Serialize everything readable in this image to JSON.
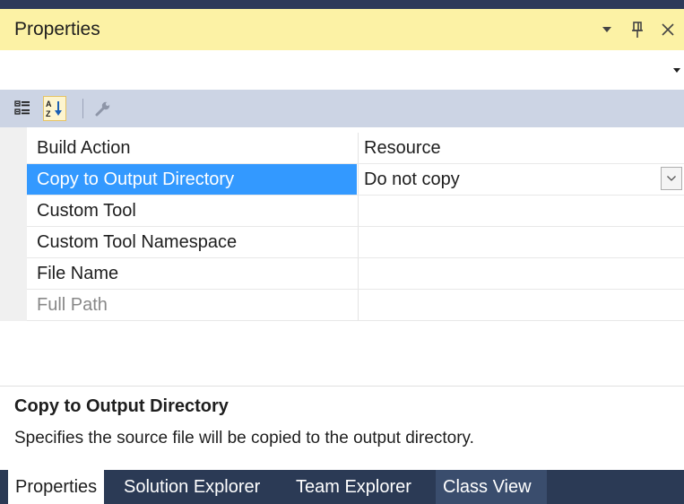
{
  "window": {
    "title": "Properties",
    "controls": [
      {
        "name": "dropdown-icon"
      },
      {
        "name": "pin-icon"
      },
      {
        "name": "close-icon"
      }
    ]
  },
  "toolbar": {
    "buttons": [
      {
        "name": "categorized-icon",
        "active": false
      },
      {
        "name": "alphabetical-sort-icon",
        "active": true
      },
      {
        "name": "property-pages-wrench-icon",
        "active": false,
        "disabled": true
      }
    ]
  },
  "properties": [
    {
      "name": "Build Action",
      "value": "Resource"
    },
    {
      "name": "Copy to Output Directory",
      "value": "Do not copy",
      "selected": true,
      "has_dropdown": true
    },
    {
      "name": "Custom Tool",
      "value": ""
    },
    {
      "name": "Custom Tool Namespace",
      "value": ""
    },
    {
      "name": "File Name",
      "value": ""
    },
    {
      "name": "Full Path",
      "value": "",
      "readonly": true
    }
  ],
  "description": {
    "title": "Copy to Output Directory",
    "text": "Specifies the source file will be copied to the output directory."
  },
  "tabs": [
    {
      "label": "Properties",
      "active": true
    },
    {
      "label": "Solution Explorer"
    },
    {
      "label": "Team Explorer"
    },
    {
      "label": "Class View"
    }
  ],
  "colors": {
    "title_bg": "#fcf2a5",
    "toolbar_bg": "#ccd4e4",
    "selection": "#3399ff",
    "tabbar_bg": "#2b3a55"
  }
}
